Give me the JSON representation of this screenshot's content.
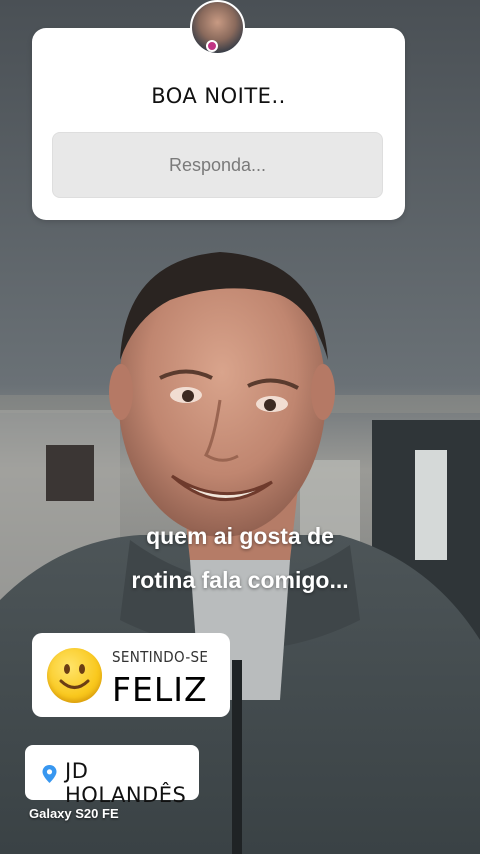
{
  "story": {
    "question": "BOA NOITE..",
    "answer_placeholder": "Responda...",
    "caption_lines": [
      "quem ai gosta de",
      "rotina fala comigo..."
    ],
    "feeling": {
      "label": "SENTINDO-SE",
      "value": "FELIZ",
      "emoji": "smiley-face-icon"
    },
    "location": {
      "name": "JD HOLANDÊS",
      "icon": "location-pin-icon",
      "pin_color": "#3897f0"
    },
    "device_watermark": "Galaxy S20 FE"
  }
}
